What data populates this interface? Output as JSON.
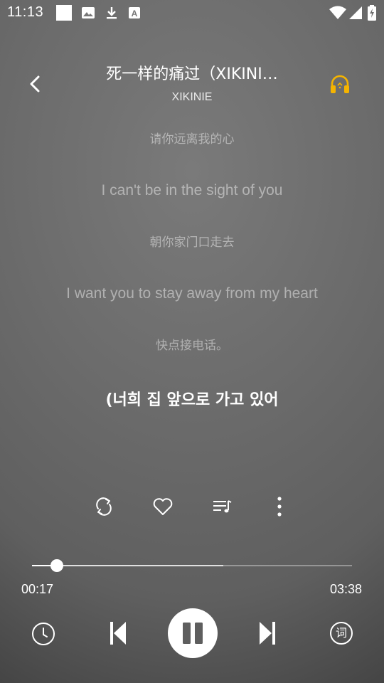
{
  "status_bar": {
    "time": "11:13",
    "left_icons": [
      "blank-notification-icon",
      "image-icon",
      "download-icon",
      "font-a-icon"
    ],
    "right_icons": [
      "wifi-icon",
      "cell-signal-icon",
      "battery-charging-icon"
    ]
  },
  "header": {
    "title": "死一样的痛过（XIKINI…",
    "artist": "XIKINIE",
    "back_icon": "chevron-left-icon",
    "headphones_icon": "headphones-icon",
    "headphones_color": "#f5b400"
  },
  "lyrics": [
    {
      "text": "请你远离我的心",
      "current": false
    },
    {
      "text": "I can't be in the sight of you",
      "current": false
    },
    {
      "text": "朝你家门口走去",
      "current": false
    },
    {
      "text": "I want you to stay away from my heart",
      "current": false
    },
    {
      "text": "快点接电话。",
      "current": false
    },
    {
      "text": "(너희 집 앞으로 가고 있어",
      "current": true
    }
  ],
  "actions": {
    "icons": [
      "repeat-icon",
      "heart-icon",
      "playlist-icon",
      "more-vertical-icon"
    ]
  },
  "playback": {
    "current_time": "00:17",
    "total_time": "03:38",
    "progress": 0.078,
    "buffered": 0.598
  },
  "controls": {
    "icons": [
      "timer-clock-icon",
      "previous-icon",
      "pause-icon",
      "next-icon",
      "lyrics-ci-icon"
    ],
    "lyrics_glyph": "词"
  }
}
